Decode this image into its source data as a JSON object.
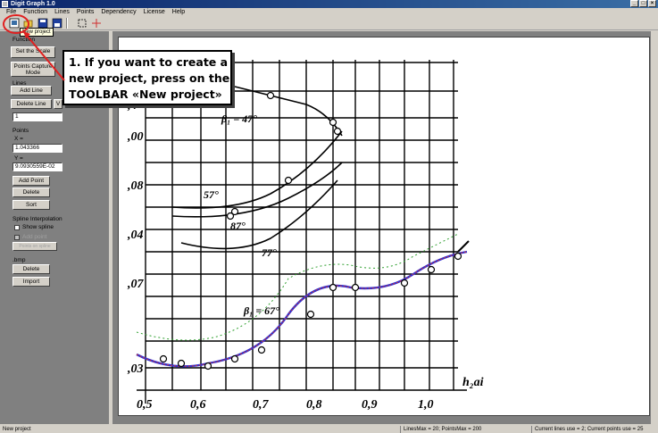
{
  "window": {
    "title": "Digit Graph 1.0",
    "buttons": [
      "_",
      "□",
      "×"
    ]
  },
  "menu": [
    "File",
    "Function",
    "Lines",
    "Points",
    "Dependency",
    "License",
    "Help"
  ],
  "toolbar": {
    "buttons": [
      "new-project-icon",
      "open-icon",
      "save-icon",
      "save-as-icon",
      "fit-icon",
      "crosshair-icon"
    ],
    "tooltip": "New project"
  },
  "left": {
    "function_label": "Function",
    "set_scale": "Set the Scale",
    "points_capture_1": "Points Capture",
    "points_capture_2": "Mode",
    "lines_label": "Lines",
    "add_line": "Add Line",
    "delete_line": "Delete Line",
    "line_field": "1",
    "points_label": "Points",
    "x_label": "X =",
    "x_value": "1.043366",
    "y_label": "Y =",
    "y_value": "9.0930559E-02",
    "add_point": "Add Point",
    "delete_point": "Delete",
    "sort": "Sort",
    "spline_label": "Spline Interpolation",
    "show_spline": "Show spline",
    "add_point_disabled": "Add point",
    "spline_btn_disabled": "Points on spline",
    "bmp_label": ".bmp",
    "bmp_delete": "Delete",
    "import": "Import"
  },
  "status": {
    "left": "New project",
    "middle": "LinesMax = 20; PointsMax = 200",
    "right": "Current lines use = 2; Current points use = 25"
  },
  "callout": {
    "line1": "1. If you want to create a",
    "line2": "new project, press on the",
    "line3": "TOOLBAR «New project»"
  },
  "graph": {
    "x_ticks": [
      "0,5",
      "0,6",
      "0,7",
      "0,8",
      "0,9",
      "1,0"
    ],
    "x_axis_label": "h₂ai",
    "y_ticks": [
      ",4",
      ",00",
      ",08",
      ",04",
      ",07",
      ",03"
    ],
    "annotations": [
      "β₁ = 47°",
      "57°",
      "87°",
      "77°",
      "β₁ = 67°"
    ]
  }
}
